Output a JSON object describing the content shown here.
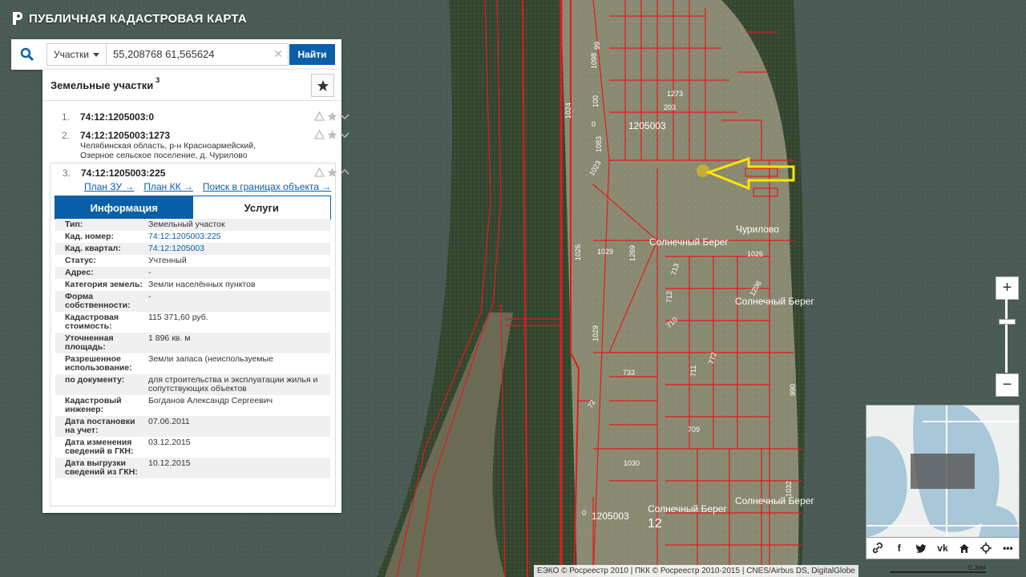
{
  "app": {
    "title": "ПУБЛИЧНАЯ КАДАСТРОВАЯ КАРТА"
  },
  "search": {
    "type_label": "Участки",
    "query": "55,208768 61,565624",
    "submit_label": "Найти"
  },
  "panel": {
    "title": "Земельные участки",
    "count": "3",
    "results": [
      {
        "num": "1.",
        "cad": "74:12:1205003:0"
      },
      {
        "num": "2.",
        "cad": "74:12:1205003:1273",
        "addr1": "Челябинская область, р-н Красноармейский,",
        "addr2": "Озерное сельское поселение, д. Чурилово"
      },
      {
        "num": "3.",
        "cad": "74:12:1205003:225"
      }
    ],
    "links": {
      "plan_zu": "План ЗУ →",
      "plan_kk": "План КК →",
      "search_bounds": "Поиск в границах объекта →"
    },
    "tabs": {
      "info": "Информация",
      "services": "Услуги"
    },
    "info": [
      {
        "label": "Тип:",
        "value": "Земельный участок"
      },
      {
        "label": "Кад. номер:",
        "value": "74:12:1205003:225",
        "link": true
      },
      {
        "label": "Кад. квартал:",
        "value": "74:12:1205003",
        "link": true
      },
      {
        "label": "Статус:",
        "value": "Учтенный"
      },
      {
        "label": "Адрес:",
        "value": "-"
      },
      {
        "label": "Категория земель:",
        "value": "Земли населённых пунктов"
      },
      {
        "label": "Форма собственности:",
        "value": "-"
      },
      {
        "label": "Кадастровая стоимость:",
        "value": "115 371,60 руб."
      },
      {
        "label": "Уточненная площадь:",
        "value": "1 896 кв. м"
      },
      {
        "label": "Разрешенное использование:",
        "value": "Земли запаса (неиспользуемые"
      },
      {
        "label": "по документу:",
        "value": "для строительства и эксплуатации жилья и сопутствующих объектов"
      },
      {
        "label": "Кадастровый инженер:",
        "value": "Богданов Александр Сергеевич"
      },
      {
        "label": "Дата постановки на учет:",
        "value": "07.06.2011"
      },
      {
        "label": "Дата изменения сведений в ГКН:",
        "value": "03.12.2015"
      },
      {
        "label": "Дата выгрузки сведений из ГКН:",
        "value": "10.12.2015"
      }
    ]
  },
  "map": {
    "labels": {
      "churilovo": "Чурилово",
      "sun1": "Солнечный Берег",
      "sun2": "Солнечный Берег",
      "sun3": "Солнечный Берег",
      "sun4": "Солнечный Берег",
      "block1": "1205003",
      "block2": "1205003",
      "district": "12"
    },
    "parcel_numbers": [
      "1098",
      "99",
      "100",
      "1024",
      "0",
      "1083",
      "1273",
      "203",
      "1023",
      "1029",
      "1026",
      "1269",
      "713",
      "712",
      "710",
      "711",
      "772",
      "1026",
      "1029",
      "733",
      "72",
      "1030",
      "709",
      "990",
      "1032",
      "0",
      "1206"
    ],
    "zoom_in": "+",
    "zoom_out": "−"
  },
  "toolbar": {
    "vk": "vk"
  },
  "footer": {
    "attribution": "ЕЭКО © Росреестр 2010 | ПКК © Росреестр 2010-2015 | CNES/Airbus DS, DigitalGlobe",
    "scale": "0,3км"
  },
  "colors": {
    "accent": "#0b5fa8",
    "parcel": "#e51a1a",
    "marker": "#ffe600"
  }
}
